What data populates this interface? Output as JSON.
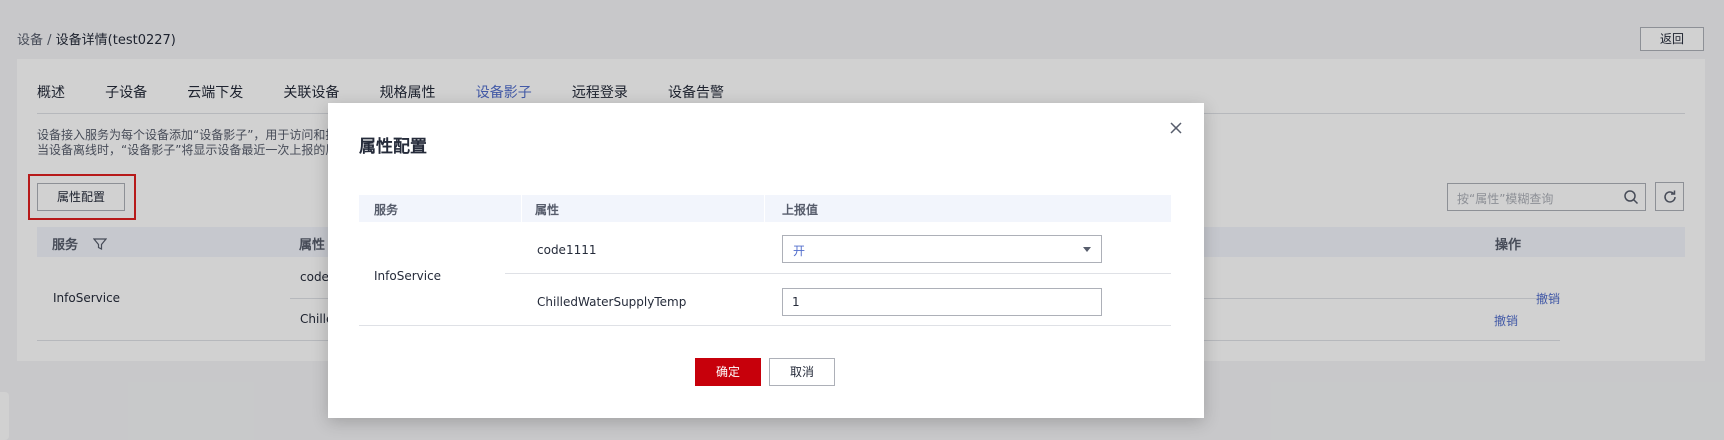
{
  "breadcrumb": {
    "root": "设备",
    "separator": " / ",
    "current": "设备详情(test0227)"
  },
  "header": {
    "back_label": "返回"
  },
  "tabs": [
    {
      "label": "概述"
    },
    {
      "label": "子设备"
    },
    {
      "label": "云端下发"
    },
    {
      "label": "关联设备"
    },
    {
      "label": "规格属性"
    },
    {
      "label": "设备影子",
      "active": true
    },
    {
      "label": "远程登录"
    },
    {
      "label": "设备告警"
    }
  ],
  "description": {
    "line1": "设备接入服务为每个设备添加“设备影子”，用于访问和控",
    "line2": "当设备离线时，“设备影子”将显示设备最近一次上报的属"
  },
  "toolbar": {
    "property_config_label": "属性配置",
    "search_placeholder": "按“属性”模糊查询"
  },
  "table": {
    "headers": {
      "service": "服务",
      "property": "属性",
      "action": "操作"
    },
    "service_value": "InfoService",
    "rows": [
      {
        "property": "code",
        "action": "撤销"
      },
      {
        "property": "Chille",
        "action": "撤销"
      }
    ]
  },
  "dialog": {
    "title": "属性配置",
    "headers": {
      "service": "服务",
      "property": "属性",
      "reported": "上报值"
    },
    "service_value": "InfoService",
    "rows": [
      {
        "property": "code1111",
        "value": "开"
      },
      {
        "property": "ChilledWaterSupplyTemp",
        "value": "1"
      }
    ],
    "confirm_label": "确定",
    "cancel_label": "取消"
  },
  "colors": {
    "accent": "#526ecc",
    "primary_button": "#c7000b",
    "highlight_border": "#e02020"
  }
}
